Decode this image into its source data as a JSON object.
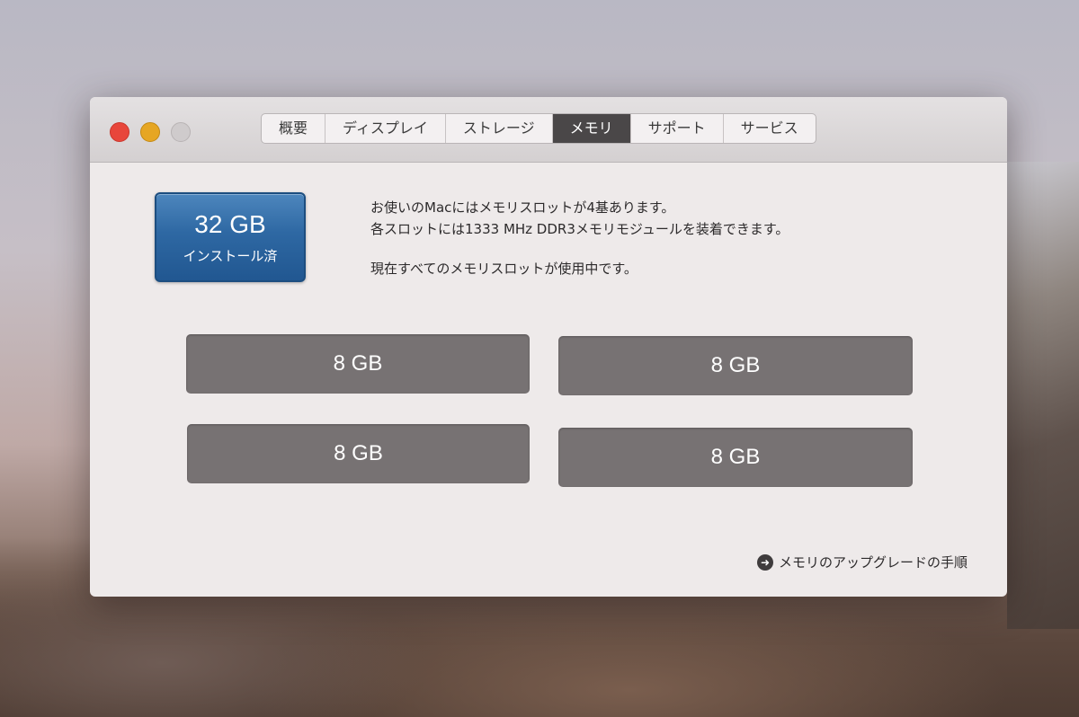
{
  "window": {
    "tabs": [
      {
        "label": "概要"
      },
      {
        "label": "ディスプレイ"
      },
      {
        "label": "ストレージ"
      },
      {
        "label": "メモリ"
      },
      {
        "label": "サポート"
      },
      {
        "label": "サービス"
      }
    ],
    "active_tab": "メモリ"
  },
  "memory": {
    "total": "32 GB",
    "installed_label": "インストール済",
    "info_lines": [
      "お使いのMacにはメモリスロットが4基あります。",
      "各スロットには1333 MHz DDR3メモリモジュールを装着できます。",
      "現在すべてのメモリスロットが使用中です。"
    ],
    "slots": [
      "8 GB",
      "8 GB",
      "8 GB",
      "8 GB"
    ],
    "upgrade_link": "メモリのアップグレードの手順"
  },
  "colors": {
    "badge_blue": "#2e68a3",
    "slot_gray": "#777273",
    "active_tab": "#4a4748",
    "close": "#e8463b",
    "minimize": "#e6a623"
  },
  "icons": [
    "close-icon",
    "minimize-icon",
    "zoom-icon",
    "arrow-right-circle-icon"
  ]
}
